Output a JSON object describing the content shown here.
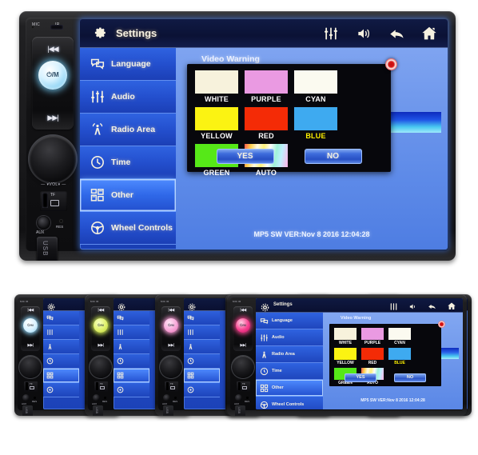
{
  "device": {
    "labels": {
      "mic": "MIC",
      "ir": "IR",
      "prev": "|◀◀",
      "next": "▶▶|",
      "power": "⏻/M",
      "vol": "—  ▾VOL▾  —",
      "tf": "TF",
      "aux": "AUX",
      "res": "RES",
      "usb": "USB"
    }
  },
  "screen": {
    "topbar": {
      "title": "Settings",
      "gear_icon": "gear-icon",
      "icons": [
        {
          "name": "equalizer-icon",
          "label": "EQ"
        },
        {
          "name": "volume-icon",
          "label": "Volume"
        },
        {
          "name": "back-arrow-icon",
          "label": "Back"
        },
        {
          "name": "home-icon",
          "label": "Home"
        }
      ]
    },
    "sidebar": {
      "items": [
        {
          "label": "Language",
          "icon": "speech-bubbles-icon",
          "active": false
        },
        {
          "label": "Audio",
          "icon": "sliders-icon",
          "active": false
        },
        {
          "label": "Radio Area",
          "icon": "radio-tower-icon",
          "active": false
        },
        {
          "label": "Time",
          "icon": "clock-icon",
          "active": false
        },
        {
          "label": "Other",
          "icon": "grid-squares-icon",
          "active": true
        },
        {
          "label": "Wheel Controls",
          "icon": "steering-wheel-icon",
          "active": false
        }
      ]
    },
    "content": {
      "panel_title": "Video Warning",
      "version_text": "MP5 SW VER:Nov  8 2016 12:04:28"
    },
    "dialog": {
      "close_icon": "close-record-dot-icon",
      "swatches": [
        {
          "name": "WHITE",
          "color": "#f7f2dc",
          "label_color": "#ffffff"
        },
        {
          "name": "PURPLE",
          "color": "#ea9ae2",
          "label_color": "#ffffff"
        },
        {
          "name": "CYAN",
          "color": "#fbfaf0",
          "label_color": "#ffffff"
        },
        {
          "name": "YELLOW",
          "color": "#fbf312",
          "label_color": "#ffffff"
        },
        {
          "name": "RED",
          "color": "#f42b06",
          "label_color": "#ffffff"
        },
        {
          "name": "BLUE",
          "color": "#3eaaf0",
          "label_color": "#fff200"
        },
        {
          "name": "GREEN",
          "color": "#56e818",
          "label_color": "#ffffff"
        },
        {
          "name": "AUTO",
          "color": "rainbow",
          "label_color": "#ffffff"
        }
      ],
      "buttons": [
        {
          "label": "YES"
        },
        {
          "label": "NO"
        }
      ]
    }
  },
  "bottom_row": {
    "units": [
      {
        "power_color": "#d7f1ff",
        "power_glow": "rgba(150,220,255,.9)"
      },
      {
        "power_color": "#dff06a",
        "power_glow": "rgba(215,245,90,.9)"
      },
      {
        "power_color": "#f8a6d8",
        "power_glow": "rgba(255,160,220,.9)"
      },
      {
        "power_color": "#62d6f5",
        "power_glow": "rgba(90,215,250,.9)"
      },
      {
        "power_color": "#5ef05e",
        "power_glow": "rgba(90,240,90,.9)"
      },
      {
        "power_color": "#f73f8e",
        "power_glow": "rgba(250,70,145,.9)"
      }
    ]
  },
  "colors": {
    "screen_blue": "#2048c4",
    "topbar_navy": "#0b1235",
    "active_item": "#4f8bff",
    "label_cream": "#f5f1e3"
  }
}
